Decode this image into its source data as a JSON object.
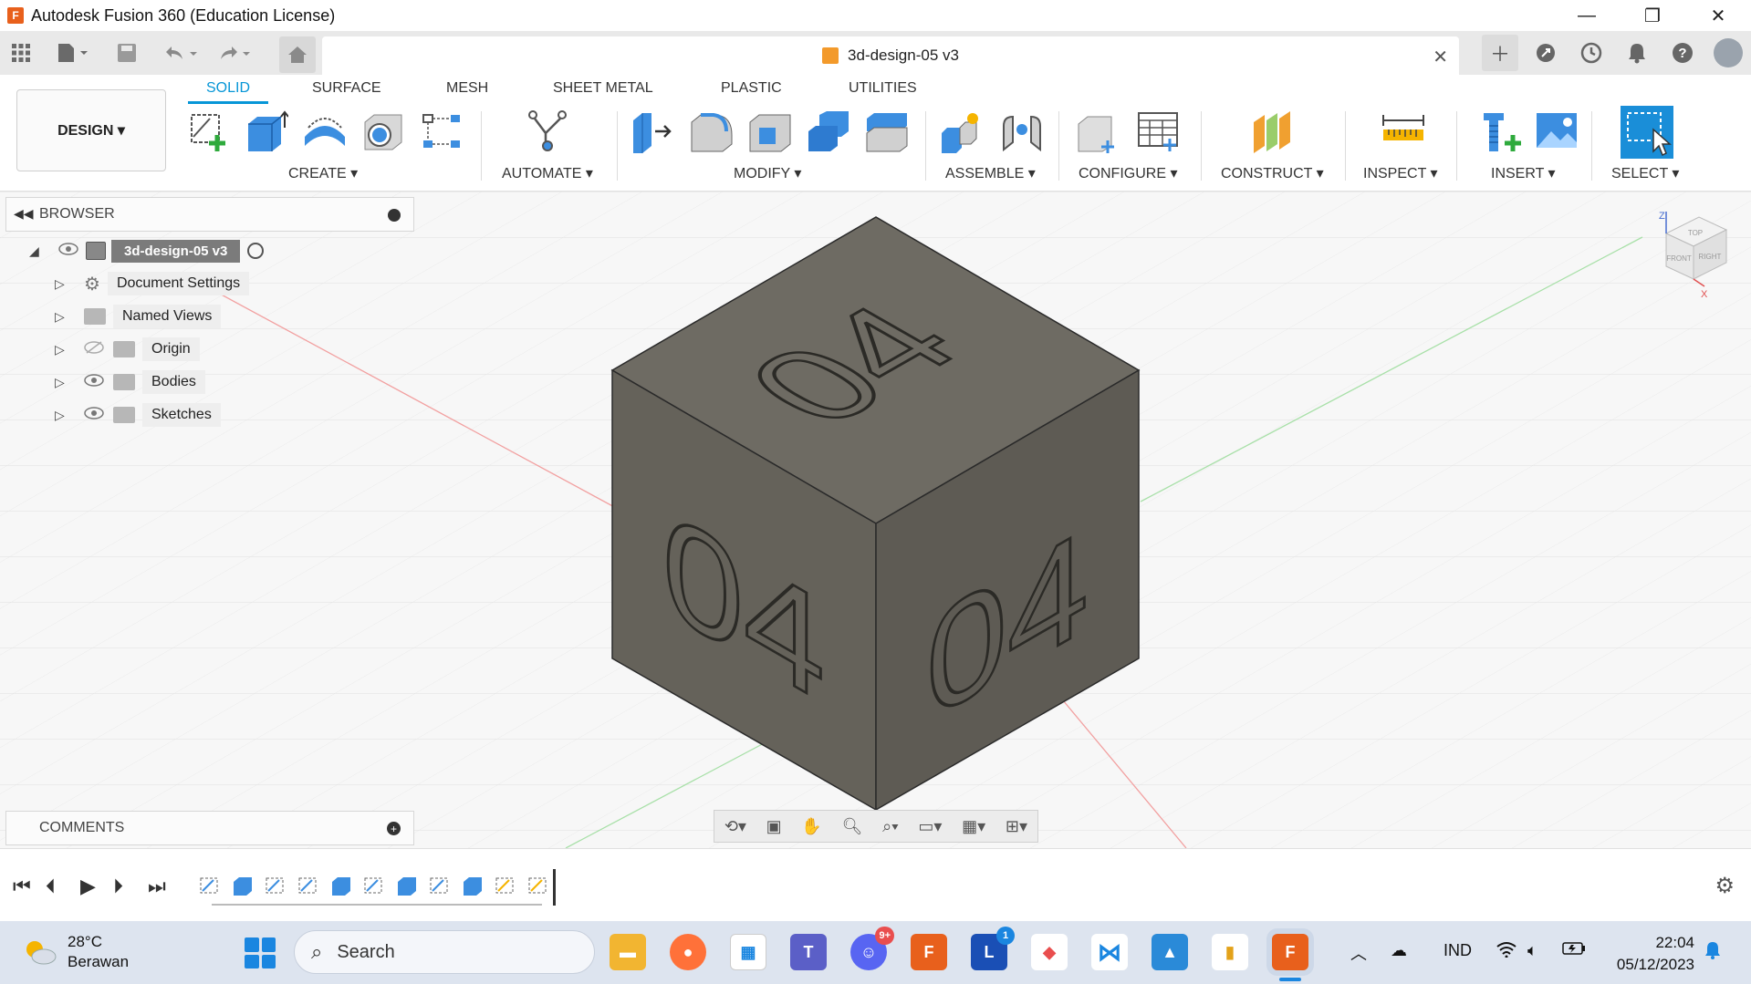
{
  "window": {
    "logo_letter": "F",
    "title": "Autodesk Fusion 360 (Education License)",
    "minimize": "—",
    "restore": "❐",
    "close": "✕"
  },
  "document_tab": {
    "title": "3d-design-05 v3",
    "close": "✕"
  },
  "quick_access": {
    "apps_icon": "grid-icon",
    "file_icon": "file-icon",
    "save_icon": "save-icon",
    "undo_icon": "undo-icon",
    "redo_icon": "redo-icon",
    "home_icon": "home-icon",
    "right": [
      "plus-icon",
      "extensions-icon",
      "job-status-icon",
      "notifications-icon",
      "help-icon",
      "avatar"
    ]
  },
  "toolbar": {
    "workspace": "DESIGN ▾",
    "tabs": [
      "SOLID",
      "SURFACE",
      "MESH",
      "SHEET METAL",
      "PLASTIC",
      "UTILITIES"
    ],
    "active_tab": "SOLID",
    "groups": [
      "CREATE ▾",
      "AUTOMATE ▾",
      "MODIFY ▾",
      "ASSEMBLE ▾",
      "CONFIGURE ▾",
      "CONSTRUCT ▾",
      "INSPECT ▾",
      "INSERT ▾",
      "SELECT ▾"
    ]
  },
  "browser": {
    "title": "BROWSER",
    "root": "3d-design-05 v3",
    "items": [
      "Document Settings",
      "Named Views",
      "Origin",
      "Bodies",
      "Sketches"
    ]
  },
  "comments": {
    "title": "COMMENTS"
  },
  "viewcube": {
    "top": "TOP",
    "front": "FRONT",
    "right": "RIGHT",
    "z": "Z",
    "x": "X"
  },
  "model": {
    "face_text_top": "04",
    "face_text_left": "04",
    "face_text_right": "04"
  },
  "taskbar": {
    "temperature": "28°C",
    "weather": "Berawan",
    "search": "Search",
    "discord_badge": "9+",
    "loop_badge": "1",
    "language": "IND",
    "time": "22:04",
    "date": "05/12/2023"
  },
  "colors": {
    "accent": "#0696d7",
    "cube_front": "#65625a",
    "cube_top": "#6e6b63",
    "cube_side": "#5e5b54"
  }
}
